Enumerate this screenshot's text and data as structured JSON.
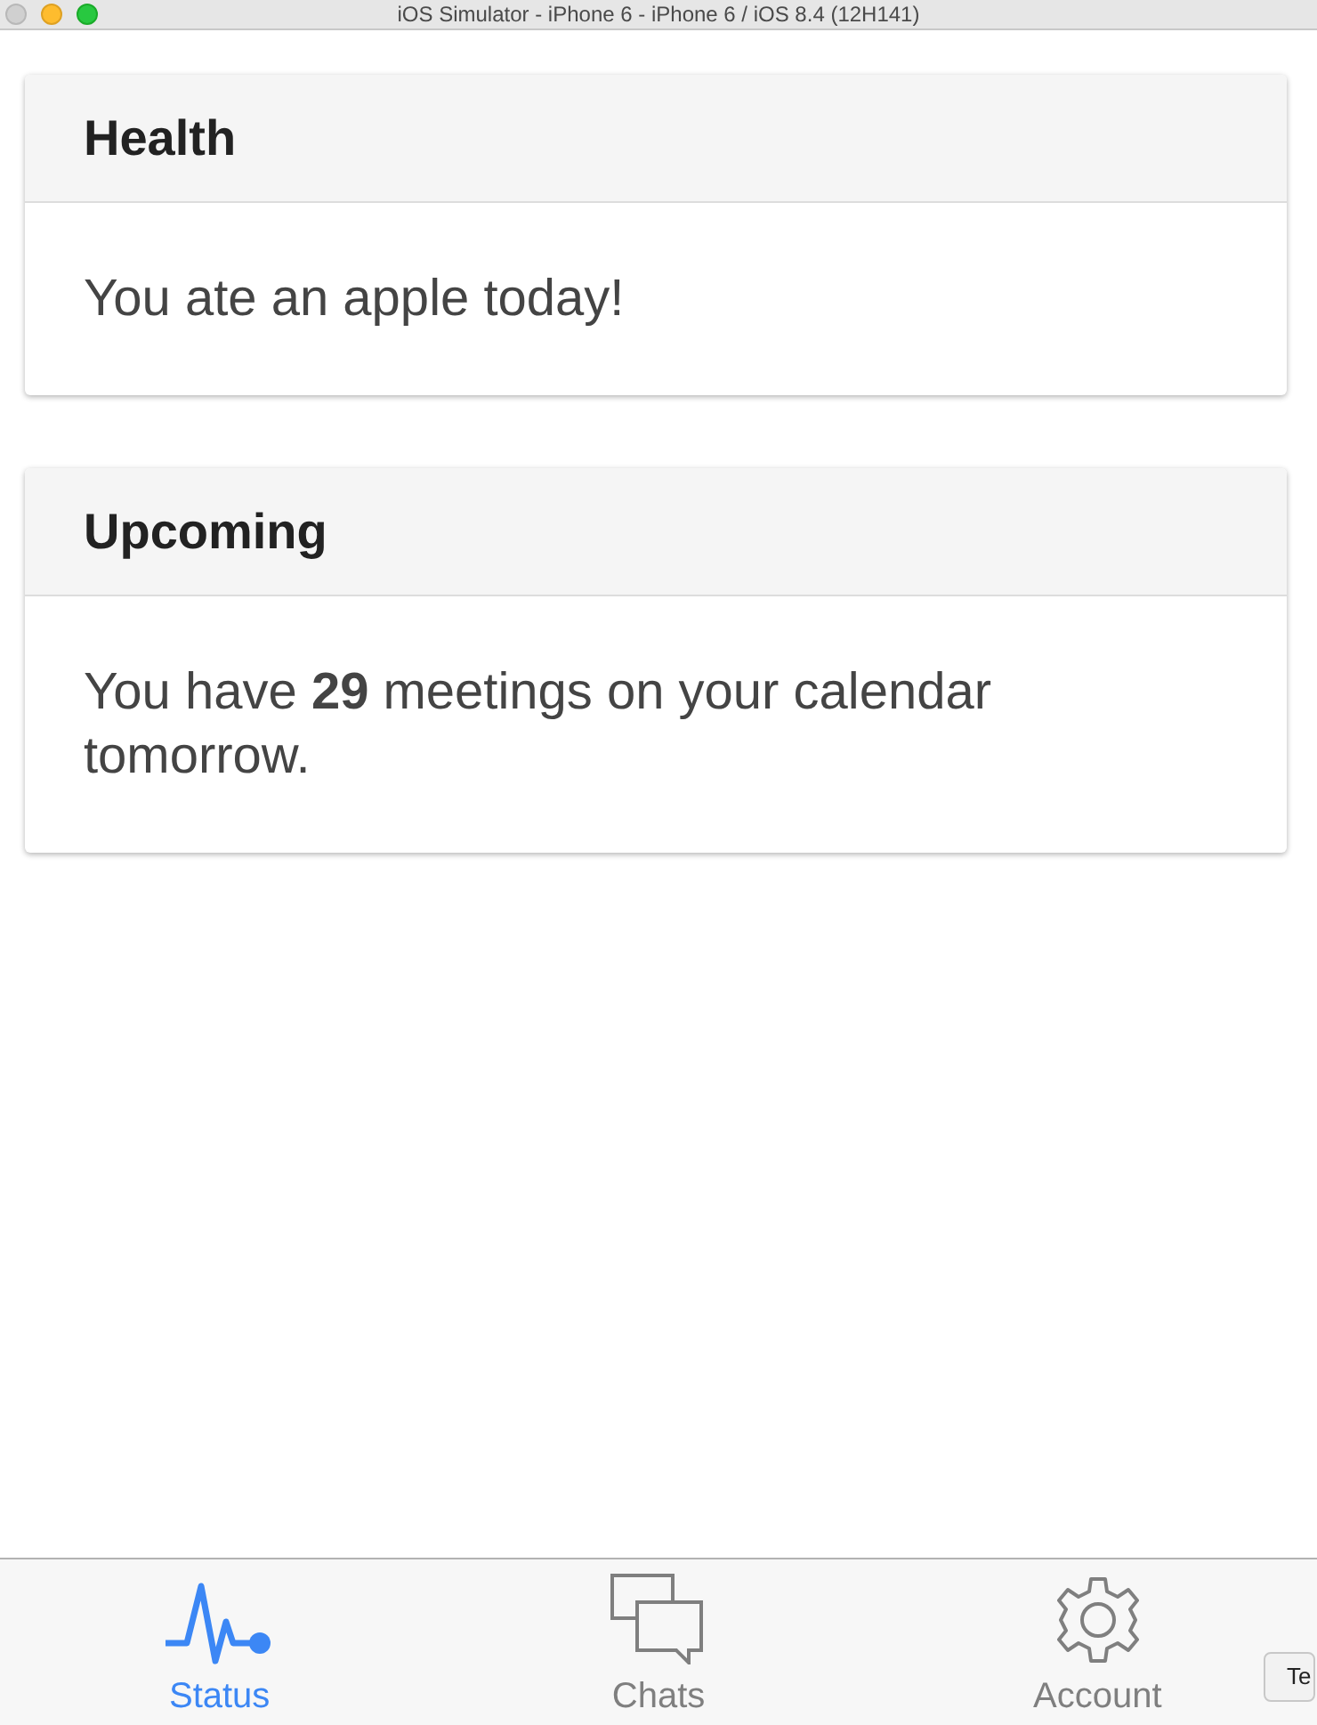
{
  "window": {
    "title": "iOS Simulator - iPhone 6 - iPhone 6 / iOS 8.4 (12H141)"
  },
  "cards": [
    {
      "title": "Health",
      "body": "You ate an apple today!"
    },
    {
      "title": "Upcoming",
      "body": "You have **29** meetings on your calendar tomorrow."
    }
  ],
  "tabs": [
    {
      "label": "Status",
      "kind": "pulse",
      "selected": true
    },
    {
      "label": "Chats",
      "kind": "chat",
      "selected": false
    },
    {
      "label": "Account",
      "kind": "gear",
      "selected": false
    }
  ],
  "overlay_button": {
    "label": "Te"
  }
}
